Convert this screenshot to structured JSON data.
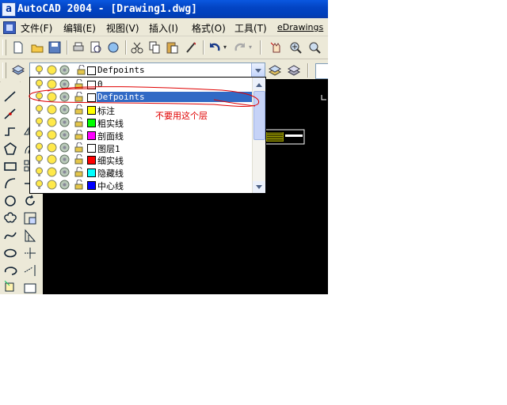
{
  "window": {
    "title": "AutoCAD 2004 - [Drawing1.dwg]"
  },
  "menubar": {
    "items": [
      "文件(F)",
      "编辑(E)",
      "视图(V)",
      "插入(I)",
      "格式(O)",
      "工具(T)",
      "eDrawings"
    ]
  },
  "layer_control": {
    "current": "Defpoints",
    "layers": [
      {
        "name": "0",
        "color": "#ffffff"
      },
      {
        "name": "Defpoints",
        "color": "#ffffff",
        "selected": true
      },
      {
        "name": "标注",
        "color": "#ffff00"
      },
      {
        "name": "粗实线",
        "color": "#00ff00"
      },
      {
        "name": "剖面线",
        "color": "#ff00ff"
      },
      {
        "name": "图层1",
        "color": "#ffffff"
      },
      {
        "name": "细实线",
        "color": "#ff0000"
      },
      {
        "name": "隐藏线",
        "color": "#00ffff"
      },
      {
        "name": "中心线",
        "color": "#0000ff"
      }
    ]
  },
  "annotation": {
    "text": "不要用这个层",
    "color": "#e00000"
  },
  "colors": {
    "titlebar": "#0344c4",
    "selection": "#316ac5",
    "canvas": "#000000",
    "annotation_ink": "#e00000"
  }
}
